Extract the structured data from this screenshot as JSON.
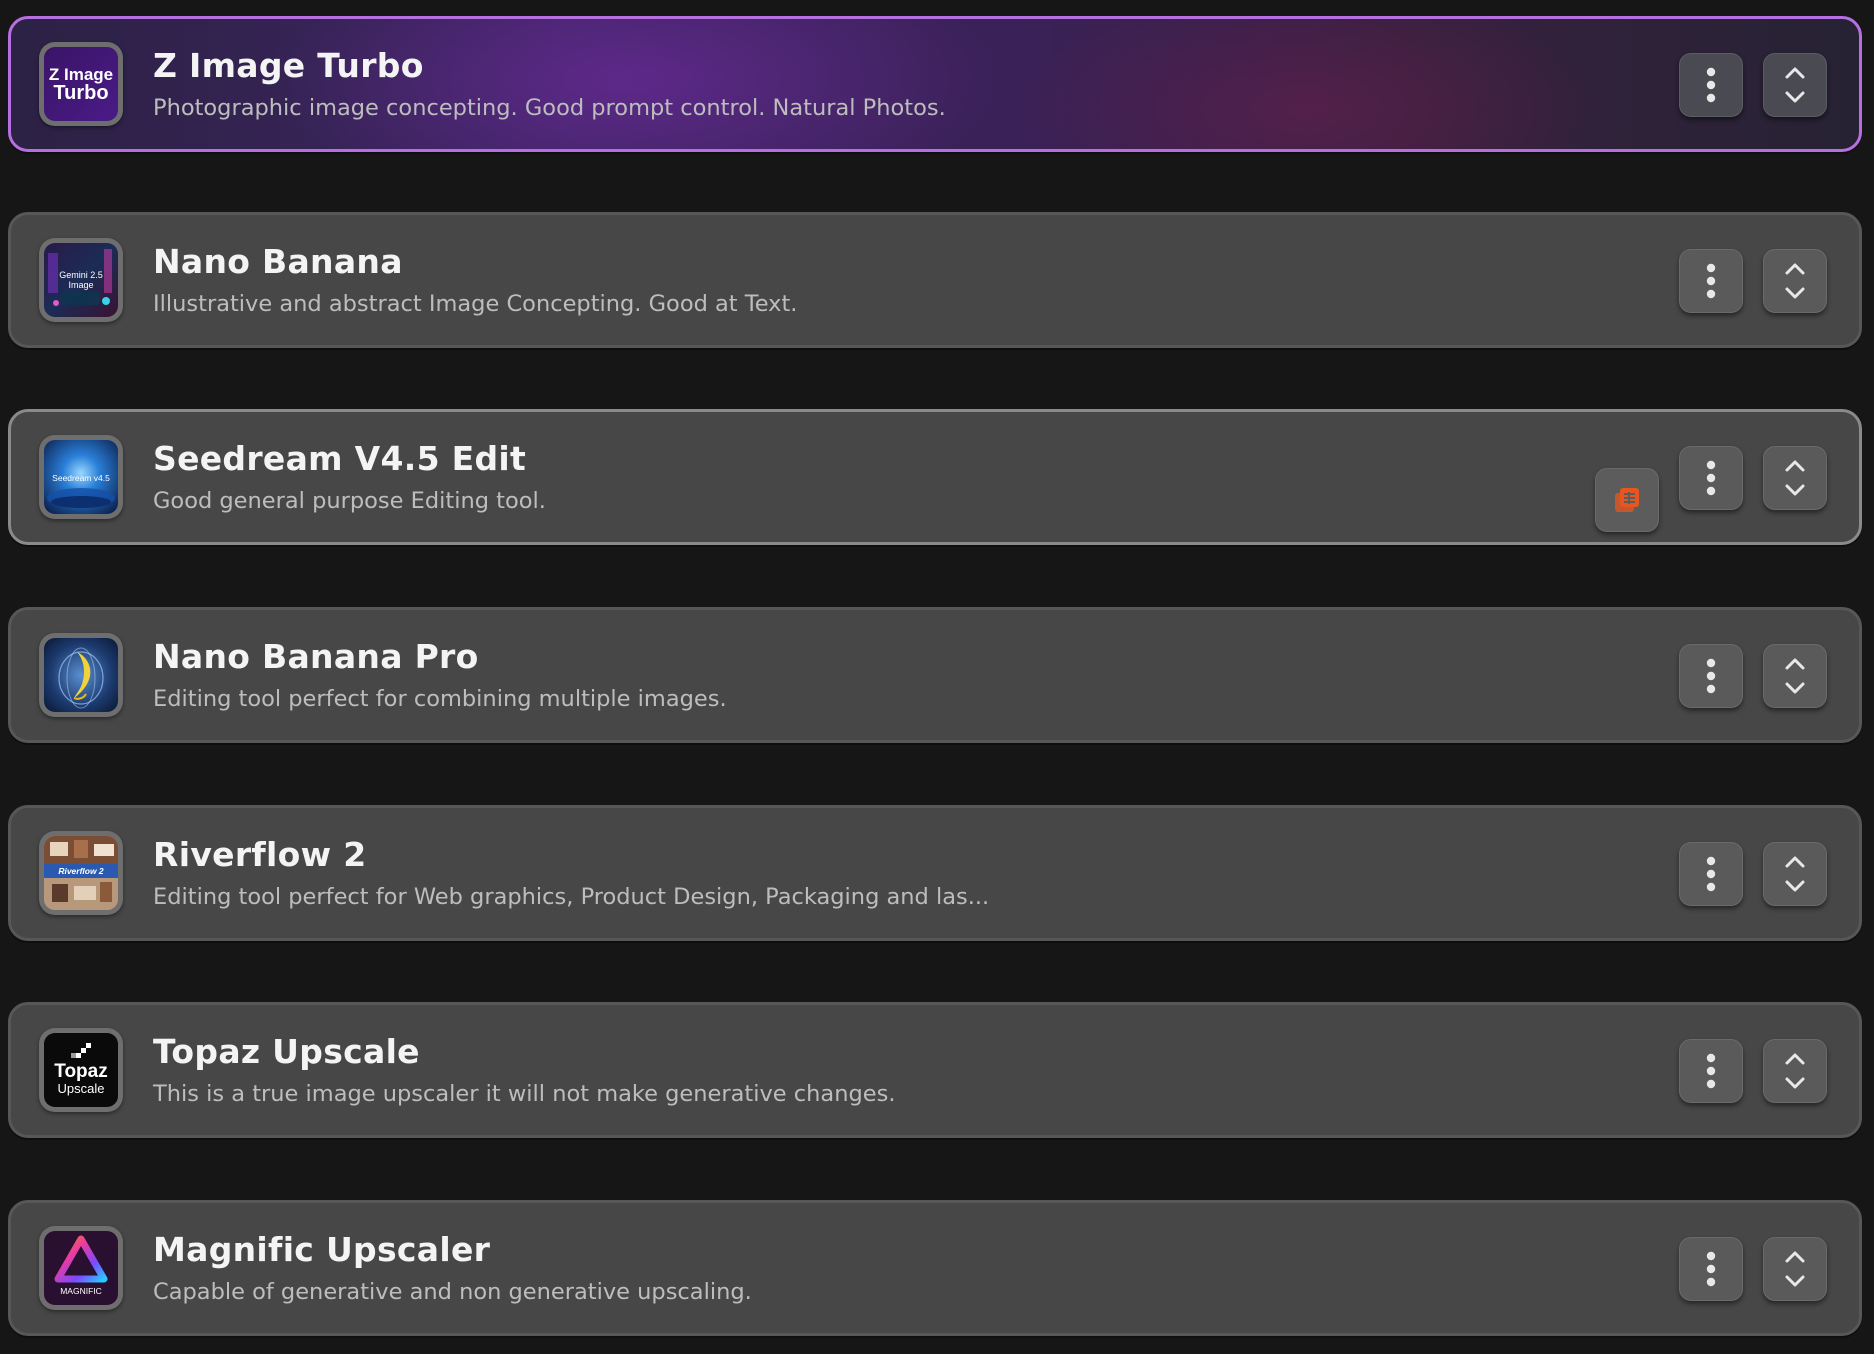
{
  "items": [
    {
      "title": "Z Image Turbo",
      "description": "Photographic image concepting. Good prompt control. Natural Photos.",
      "thumb_text": [
        "Z Image",
        "Turbo"
      ],
      "icon": "z-image-turbo-logo",
      "selected": true
    },
    {
      "title": "Nano Banana",
      "description": "Illustrative and abstract Image Concepting. Good at Text.",
      "thumb_text": [
        "Gemini 2.5",
        "Image"
      ],
      "icon": "nano-banana-thumbnail"
    },
    {
      "title": "Seedream V4.5 Edit",
      "description": "Good general purpose Editing tool.",
      "thumb_text": [
        "Seedream v4.5"
      ],
      "icon": "seedream-thumbnail",
      "extra_badge_icon": "layers-icon",
      "extra_badge_color": "#e8561f"
    },
    {
      "title": "Nano Banana Pro",
      "description": "Editing tool perfect for combining multiple images.",
      "icon": "nano-banana-pro-thumbnail"
    },
    {
      "title": "Riverflow 2",
      "description": "Editing tool perfect for Web graphics, Product Design, Packaging and las...",
      "thumb_text": [
        "Riverflow 2"
      ],
      "icon": "riverflow-thumbnail"
    },
    {
      "title": "Topaz Upscale",
      "description": "This is a true image upscaler it will not make generative changes.",
      "thumb_text": [
        "Topaz",
        "Upscale"
      ],
      "icon": "topaz-logo"
    },
    {
      "title": "Magnific Upscaler",
      "description": "Capable of generative and non generative upscaling.",
      "thumb_text": [
        "MAGNIFIC"
      ],
      "icon": "magnific-logo"
    }
  ],
  "colors": {
    "background": "#161616",
    "card": "#474747",
    "selected_border": "#b66fe0",
    "title": "#f4f4f4",
    "description": "#bdbdbd"
  },
  "button_icons": {
    "menu": "vertical-dots-icon",
    "reorder": "chevron-up-down-icon"
  }
}
